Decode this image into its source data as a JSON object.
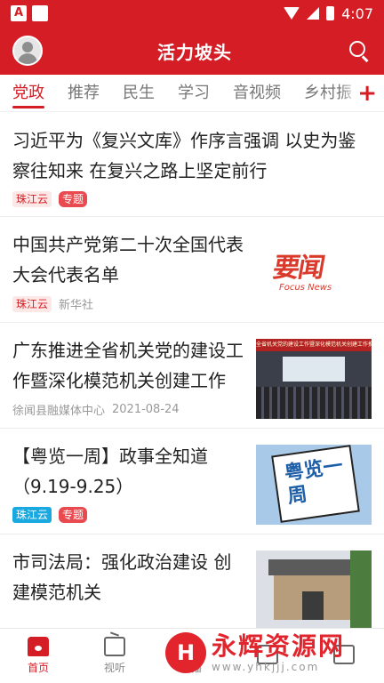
{
  "status": {
    "time": "4:07"
  },
  "header": {
    "title": "活力坡头"
  },
  "tabs": [
    "党政",
    "推荐",
    "民生",
    "学习",
    "音视频",
    "乡村振"
  ],
  "feed": [
    {
      "title": "习近平为《复兴文库》作序言强调 以史为鉴 察往知来 在复兴之路上坚定前行",
      "tag1": "珠江云",
      "tag2": "专题"
    },
    {
      "title": "中国共产党第二十次全国代表大会代表名单",
      "tag1": "珠江云",
      "source": "新华社",
      "thumb_big": "要闻",
      "thumb_small": "Focus News"
    },
    {
      "title": "广东推进全省机关党的建设工作暨深化模范机关创建工作",
      "source": "徐闻县融媒体中心",
      "date": "2021-08-24",
      "thumb_banner": "全省机关党的建设工作暨深化模范机关创建工作推进会"
    },
    {
      "title": "【粤览一周】政事全知道（9.19-9.25）",
      "tag1": "珠江云",
      "tag2": "专题",
      "thumb_text": "粤览一周"
    },
    {
      "title": "市司法局：强化政治建设 创建模范机关"
    }
  ],
  "bottom_nav": [
    {
      "label": "首页"
    },
    {
      "label": "视听"
    },
    {
      "label": "直播"
    },
    {
      "label": ""
    },
    {
      "label": ""
    }
  ],
  "watermark": {
    "main": "永辉资源网",
    "sub": "www.yhkjjj.com"
  }
}
